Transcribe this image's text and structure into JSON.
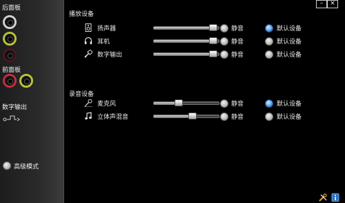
{
  "window": {
    "minimize_symbol": "–",
    "close_symbol": "×"
  },
  "left_panel": {
    "rear_label": "后面板",
    "front_label": "前面板",
    "digital_label": "数字输出",
    "advanced_label": "高级模式",
    "rear_jacks": [
      {
        "color": "#0a0a0a"
      },
      {
        "color": "#b7c23a"
      },
      {
        "color": "#2a0c10"
      }
    ],
    "front_jacks": [
      {
        "color": "#c2303f"
      },
      {
        "color": "#b7c23a"
      }
    ]
  },
  "playback": {
    "title": "播放设备",
    "devices": [
      {
        "name": "扬声器",
        "icon": "speaker-icon",
        "volume": 0.92,
        "mute_label": "静音",
        "default_label": "默认设备",
        "is_default": true
      },
      {
        "name": "耳机",
        "icon": "headphones-icon",
        "volume": 0.92,
        "mute_label": "静音",
        "default_label": "默认设备",
        "is_default": false
      },
      {
        "name": "数字输出",
        "icon": "digital-out-icon",
        "volume": 0.92,
        "mute_label": "静音",
        "default_label": "默认设备",
        "is_default": false
      }
    ]
  },
  "recording": {
    "title": "录音设备",
    "devices": [
      {
        "name": "麦克风",
        "icon": "microphone-icon",
        "volume": 0.38,
        "mute_label": "静音",
        "default_label": "默认设备",
        "is_default": true
      },
      {
        "name": "立体声混音",
        "icon": "music-note-icon",
        "volume": 0.6,
        "mute_label": "静音",
        "default_label": "默认设备",
        "is_default": false
      }
    ]
  },
  "bottom_icons": [
    "tools-icon",
    "info-icon"
  ],
  "colors": {
    "accent_blue": "#5aa0e8",
    "background": "#000000"
  }
}
